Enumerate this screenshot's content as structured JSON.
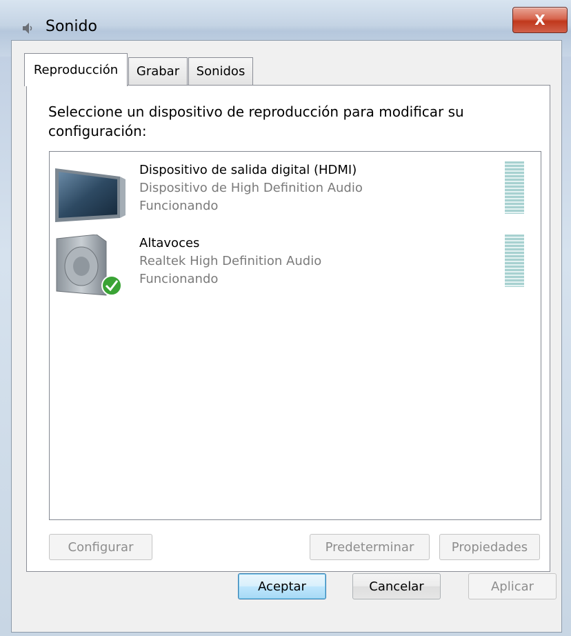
{
  "window": {
    "title": "Sonido",
    "close_label": "X"
  },
  "tabs": [
    {
      "label": "Reproducción",
      "active": true
    },
    {
      "label": "Grabar",
      "active": false
    },
    {
      "label": "Sonidos",
      "active": false
    }
  ],
  "instruction": "Seleccione un dispositivo de reproducción para modificar su configuración:",
  "devices": [
    {
      "icon": "monitor-icon",
      "name": "Dispositivo de salida digital (HDMI)",
      "description": "Dispositivo de High Definition Audio",
      "status": "Funcionando",
      "is_default": false
    },
    {
      "icon": "speaker-icon",
      "name": "Altavoces",
      "description": "Realtek High Definition Audio",
      "status": "Funcionando",
      "is_default": true
    }
  ],
  "list_buttons": {
    "configure": "Configurar",
    "set_default": "Predeterminar",
    "properties": "Propiedades"
  },
  "dialog_buttons": {
    "ok": "Aceptar",
    "cancel": "Cancelar",
    "apply": "Aplicar"
  },
  "colors": {
    "accent": "#3c7fb1",
    "meter": "#a7d1d0",
    "check": "#3aa335"
  }
}
